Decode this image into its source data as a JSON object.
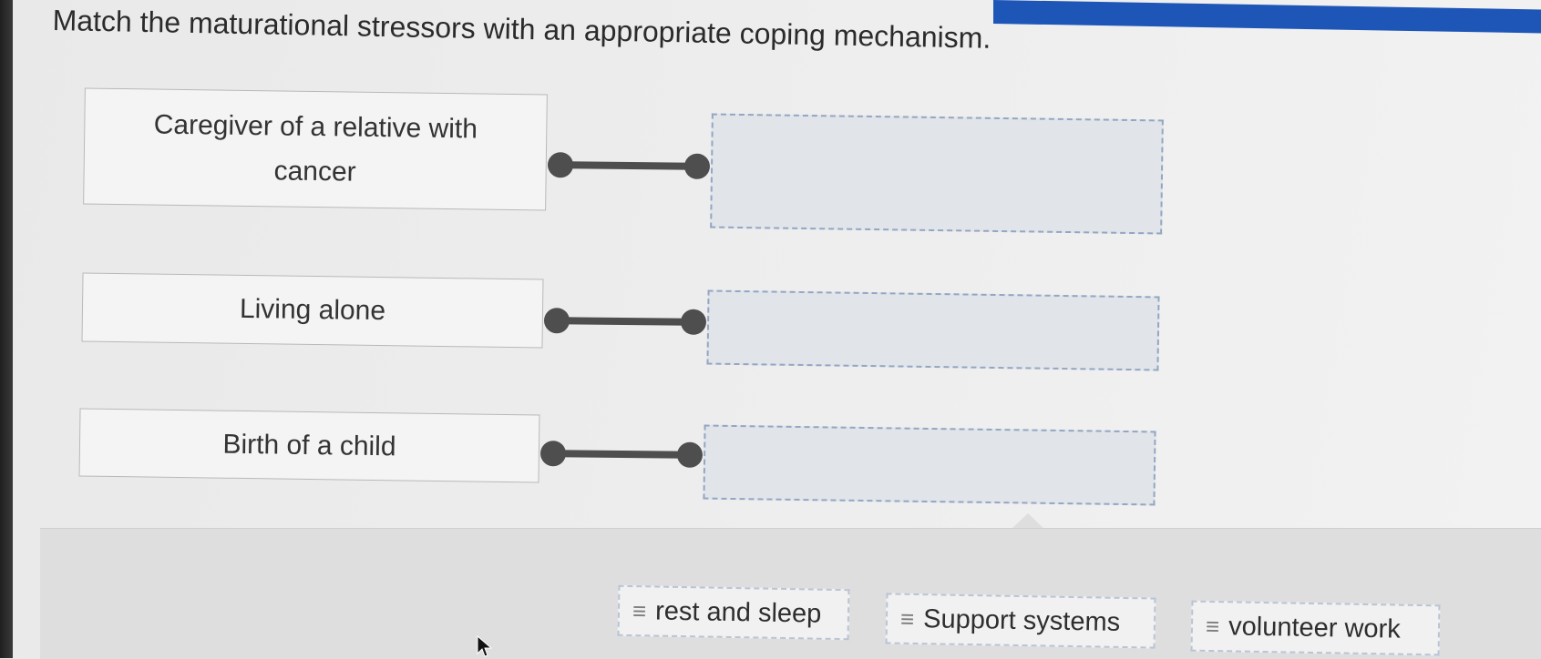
{
  "question": "Match the maturational stressors with an appropriate coping mechanism.",
  "premises": [
    {
      "label": "Caregiver of a relative with cancer"
    },
    {
      "label": "Living alone"
    },
    {
      "label": "Birth of a child"
    }
  ],
  "answer_bank": [
    {
      "label": "rest and sleep"
    },
    {
      "label": "Support systems"
    },
    {
      "label": "volunteer work"
    }
  ],
  "icons": {
    "grip": "≡",
    "grip_name": "drag-handle-icon",
    "cursor_name": "mouse-cursor-icon"
  },
  "colors": {
    "connector": "#4e4e4e",
    "drop_border": "#93a6c2",
    "top_bar": "#1e56b8"
  }
}
